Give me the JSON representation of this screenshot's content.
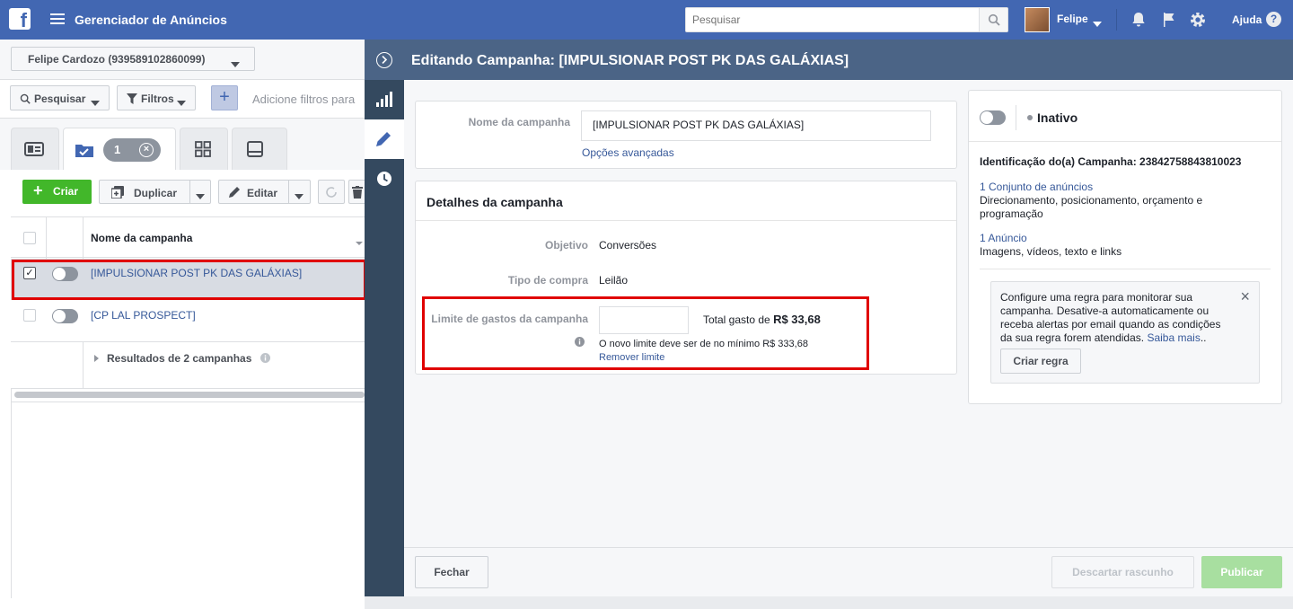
{
  "topbar": {
    "logo": "f",
    "app_title": "Gerenciador de Anúncios",
    "search_placeholder": "Pesquisar",
    "user_name": "Felipe",
    "help_label": "Ajuda",
    "help_icon": "?",
    "icons": [
      "facebook-logo-icon",
      "hamburger-menu-icon",
      "search-icon",
      "bell-icon",
      "flag-icon",
      "gear-icon",
      "help-icon"
    ]
  },
  "account": {
    "selector_label": "Felipe Cardozo (939589102860099)"
  },
  "filters": {
    "search_btn": "Pesquisar",
    "filters_btn": "Filtros",
    "add_filter_icon": "+",
    "hint": "Adicione filtros para"
  },
  "tabs": {
    "selected_count": "1",
    "clear_icon": "×"
  },
  "toolbar": {
    "create": "Criar",
    "create_icon": "+",
    "duplicate": "Duplicar",
    "edit": "Editar"
  },
  "table": {
    "column_name": "Nome da campanha",
    "rows": [
      {
        "name": "[IMPULSIONAR POST PK DAS GALÁXIAS]",
        "checked": true,
        "active": false
      },
      {
        "name": "[CP LAL PROSPECT]",
        "checked": false,
        "active": false
      }
    ],
    "results_label": "Resultados de 2 campanhas",
    "checkmark": "✓"
  },
  "drawer": {
    "title": "Editando Campanha: [IMPULSIONAR POST PK DAS GALÁXIAS]",
    "name_label": "Nome da campanha",
    "name_value": "[IMPULSIONAR POST PK DAS GALÁXIAS]",
    "advanced_options": "Opções avançadas",
    "details_title": "Detalhes da campanha",
    "objective_label": "Objetivo",
    "objective_value": "Conversões",
    "buy_type_label": "Tipo de compra",
    "buy_type_value": "Leilão",
    "limit_label": "Limite de gastos da campanha",
    "total_spent_label": "Total gasto de",
    "total_spent_value": "R$ 33,68",
    "limit_hint": "O novo limite deve ser de no mínimo R$ 333,68",
    "remove_limit": "Remover limite",
    "info_icon": "i",
    "close_btn": "Fechar",
    "discard_btn": "Descartar rascunho",
    "publish_btn": "Publicar"
  },
  "right_panel": {
    "status": "Inativo",
    "campaign_id_label": "Identificação do(a) Campanha: 23842758843810023",
    "adset_link": "1 Conjunto de anúncios",
    "adset_desc": "Direcionamento, posicionamento, orçamento e programação",
    "ad_link": "1 Anúncio",
    "ad_desc": "Imagens, vídeos, texto e links",
    "rule_text": "Configure uma regra para monitorar sua campanha. Desative-a automaticamente ou receba alertas por email quando as condições da sua regra forem atendidas.",
    "rule_link": "Saiba mais",
    "rule_trailing": "..",
    "rule_close_icon": "×",
    "create_rule_btn": "Criar regra"
  },
  "colors": {
    "topbar": "#4267b2",
    "drawer_header": "#4b6486",
    "side_rail": "#34495f",
    "create_green": "#42b72a",
    "publish_disabled": "#a8dfa0",
    "highlight_red": "#e00000",
    "link": "#365899"
  }
}
